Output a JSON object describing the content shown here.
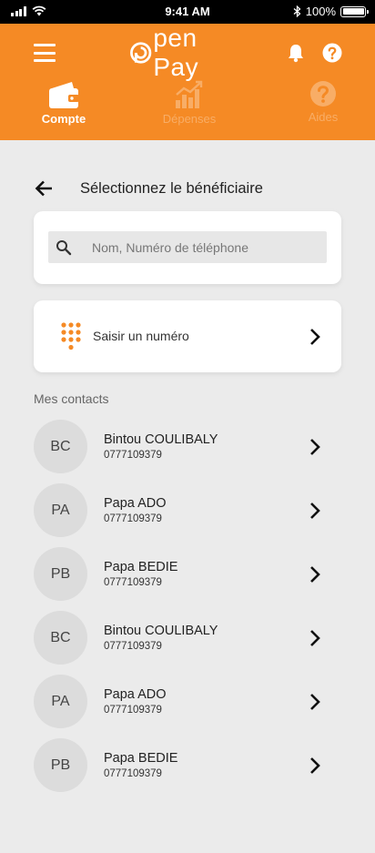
{
  "status_bar": {
    "time": "9:41 AM",
    "battery": "100%",
    "icons": [
      "signal-icon",
      "wifi-icon",
      "bluetooth-icon",
      "battery-icon"
    ]
  },
  "header": {
    "logo_text": "pen Pay",
    "icons": [
      "menu-icon",
      "bell-icon",
      "help-icon"
    ],
    "tabs": [
      {
        "label": "Compte",
        "icon": "wallet-icon",
        "active": true
      },
      {
        "label": "Dépenses",
        "icon": "bar-chart-icon",
        "active": false
      },
      {
        "label": "Aides",
        "icon": "help-circle-icon",
        "active": false
      }
    ]
  },
  "screen": {
    "title": "Sélectionnez le bénéficiaire",
    "search": {
      "placeholder": "Nom, Numéro de téléphone",
      "value": ""
    },
    "dial_label": "Saisir un numéro",
    "contacts_heading": "Mes contacts",
    "contacts": [
      {
        "initials": "BC",
        "name": "Bintou COULIBALY",
        "phone": "0777109379"
      },
      {
        "initials": "PA",
        "name": "Papa ADO",
        "phone": "0777109379"
      },
      {
        "initials": "PB",
        "name": "Papa BEDIE",
        "phone": "0777109379"
      },
      {
        "initials": "BC",
        "name": "Bintou COULIBALY",
        "phone": "0777109379"
      },
      {
        "initials": "PA",
        "name": "Papa ADO",
        "phone": "0777109379"
      },
      {
        "initials": "PB",
        "name": "Papa BEDIE",
        "phone": "0777109379"
      }
    ]
  },
  "colors": {
    "brand": "#f58a25",
    "inactive_tab": "#f8ad66",
    "background": "#ebebeb"
  }
}
